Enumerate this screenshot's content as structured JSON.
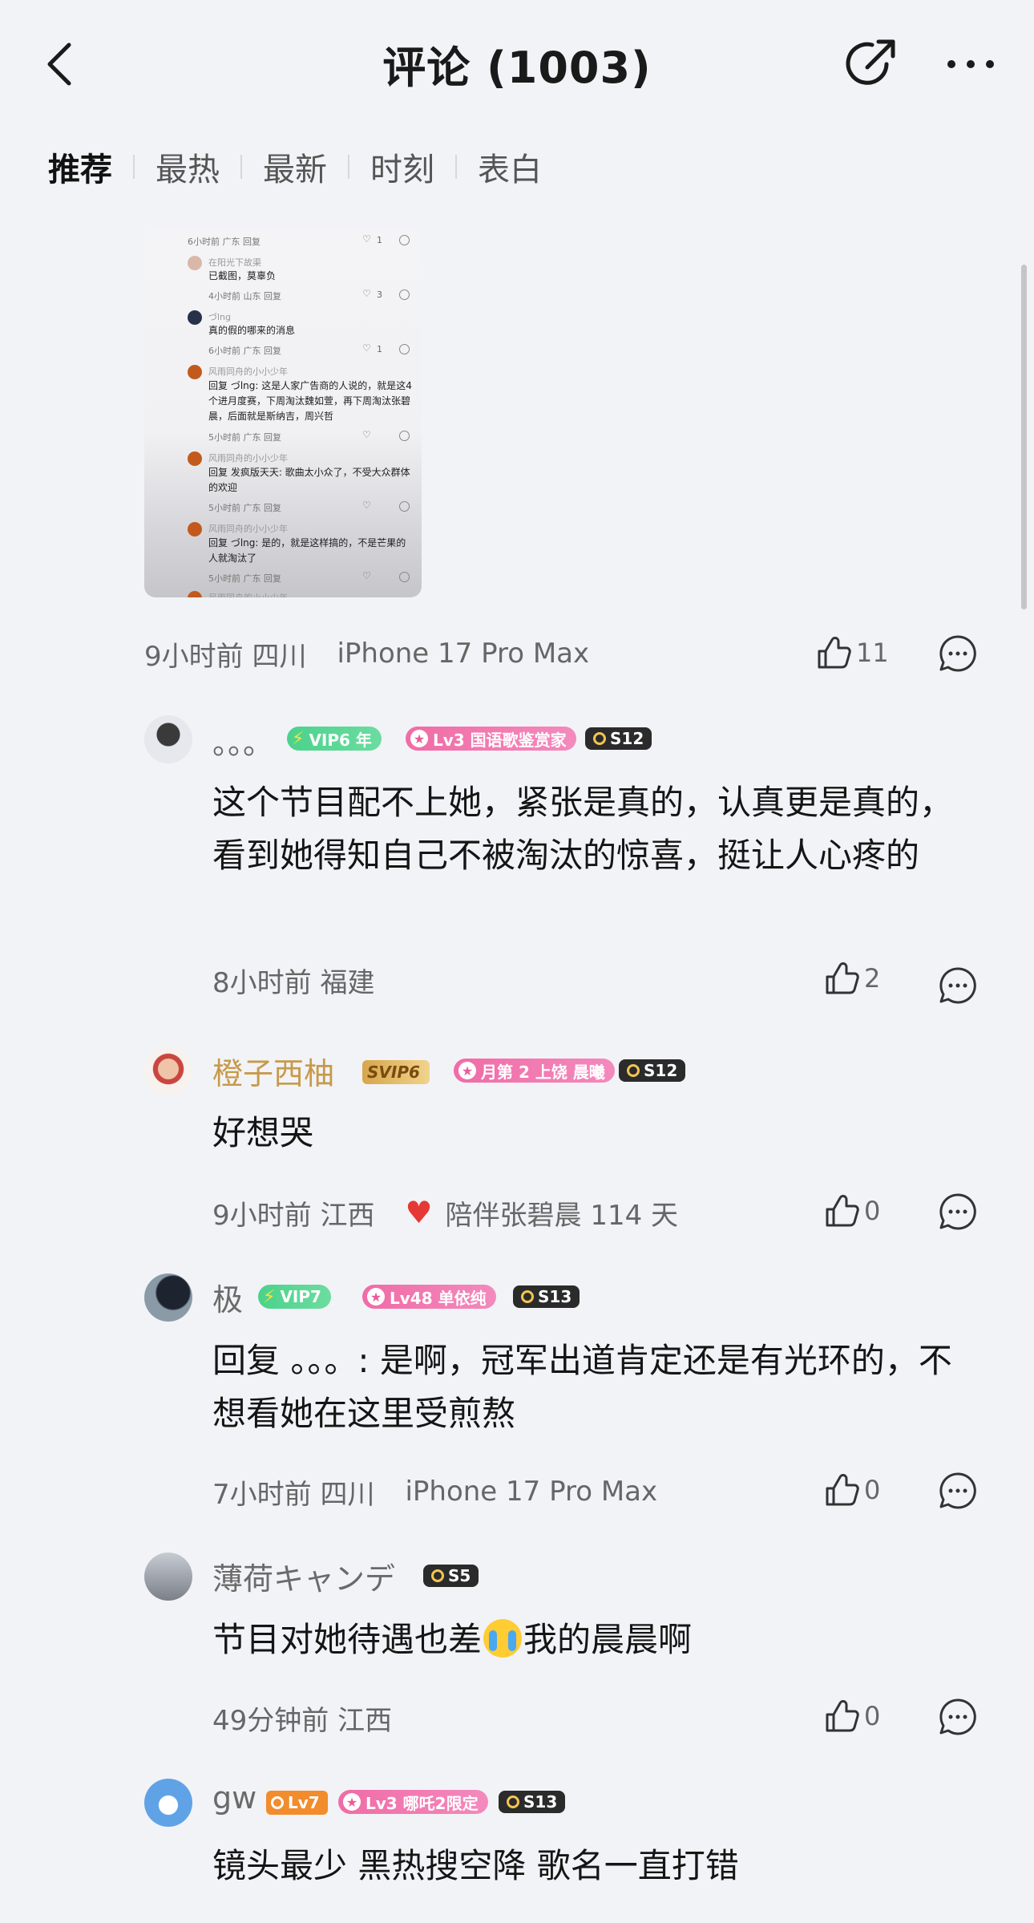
{
  "header": {
    "title": "评论 (1003)",
    "back_icon": "chevron-left-icon",
    "share_icon": "share-icon",
    "more_icon": "more-icon"
  },
  "tabs": [
    {
      "label": "推荐",
      "active": true
    },
    {
      "label": "最热",
      "active": false
    },
    {
      "label": "最新",
      "active": false
    },
    {
      "label": "时刻",
      "active": false
    },
    {
      "label": "表白",
      "active": false
    }
  ],
  "screenshot": {
    "items": [
      {
        "meta": "6小时前 广东   回复",
        "likes": "1"
      },
      {
        "name": "在阳光下故渠",
        "text": "已截图，莫辜负",
        "meta": "4小时前 山东   回复",
        "likes": "3"
      },
      {
        "name": "づlng",
        "text": "真的假的哪来的消息",
        "meta": "6小时前 广东   回复",
        "likes": "1"
      },
      {
        "name": "风雨同舟的小小少年",
        "text": "回复 づlng: 这是人家广告商的人说的，就是这4个进月度赛，下周淘汰魏如萱，再下周淘汰张碧晨，后面就是斯纳吉，周兴哲",
        "meta": "5小时前 广东   回复",
        "likes": ""
      },
      {
        "name": "风雨同舟的小小少年",
        "text": "回复 发疯版天天: 歌曲太小众了，不受大众群体的欢迎",
        "meta": "5小时前 广东   回复",
        "likes": ""
      },
      {
        "name": "风雨同舟的小小少年",
        "text": "回复 づlng: 是的，就是这样搞的，不是芒果的人就淘汰了",
        "meta": "5小时前 广东   回复",
        "likes": ""
      },
      {
        "name": "风雨同舟的小小少年"
      }
    ]
  },
  "post_meta": {
    "time_location": "9小时前 四川",
    "device": "iPhone 17 Pro Max",
    "likes": "11"
  },
  "comments": [
    {
      "username": "。。。",
      "badges": {
        "vip": "VIP6 年",
        "lv": "Lv3 国语歌鉴赏家",
        "season": "S12"
      },
      "text": "这个节目配不上她，紧张是真的，认真更是真的，看到她得知自己不被淘汰的惊喜，挺让人心疼的",
      "time_location": "8小时前 福建",
      "likes": "2"
    },
    {
      "username": "橙子西柚",
      "badges": {
        "vip": "SVIP6",
        "lv": "月第 2 上饶 晨曦",
        "season": "S12"
      },
      "text": "好想哭",
      "time_location": "9小时前 江西",
      "companion": "陪伴张碧晨 114 天",
      "likes": "0"
    },
    {
      "username": "极",
      "badges": {
        "vip": "VIP7",
        "lv": "Lv48 单依纯",
        "season": "S13"
      },
      "text": "回复 。。。: 是啊，冠军出道肯定还是有光环的，不想看她在这里受煎熬",
      "time_location": "7小时前 四川",
      "device": "iPhone 17 Pro Max",
      "likes": "0"
    },
    {
      "username": "薄荷キャンデ",
      "badges": {
        "season": "S5"
      },
      "text_before": "节目对她待遇也差",
      "text_after": "我的晨晨啊",
      "time_location": "49分钟前 江西",
      "likes": "0"
    },
    {
      "username": "gw",
      "badges": {
        "vip": "Lv7",
        "lv": "Lv3 哪吒2限定",
        "season": "S13"
      },
      "text": "镜头最少 黑热搜空降 歌名一直打错"
    }
  ],
  "colors": {
    "background": "#f2f3f7",
    "vip_green": "#4bd28c",
    "lv_pink": "#f06ca6",
    "svip_gold": "#d7a64b",
    "red_heart": "#e53935"
  }
}
